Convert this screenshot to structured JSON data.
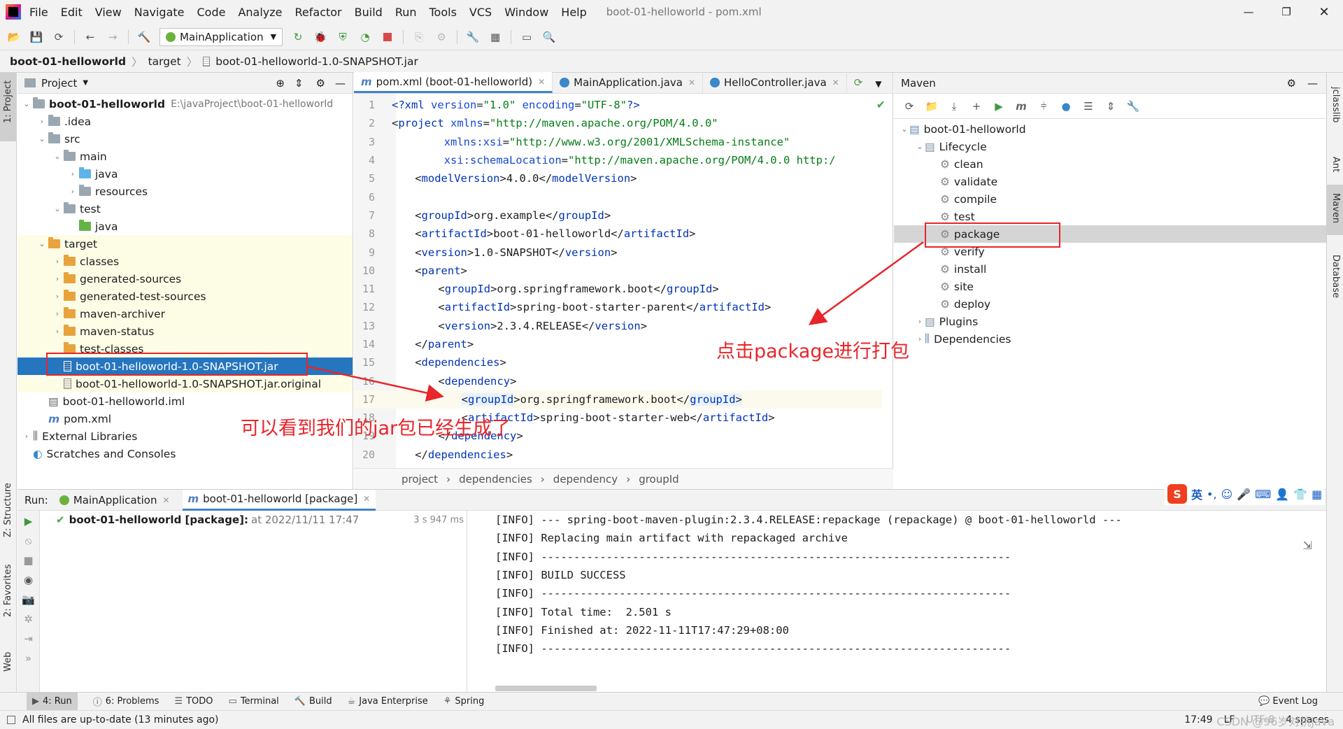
{
  "menubar": {
    "items": [
      "File",
      "Edit",
      "View",
      "Navigate",
      "Code",
      "Analyze",
      "Refactor",
      "Build",
      "Run",
      "Tools",
      "VCS",
      "Window",
      "Help"
    ],
    "title": "boot-01-helloworld - pom.xml"
  },
  "toolbar": {
    "run_config": "MainApplication"
  },
  "navbar": {
    "crumbs": [
      "boot-01-helloworld",
      "target",
      "boot-01-helloworld-1.0-SNAPSHOT.jar"
    ]
  },
  "leftstrip": {
    "project": "1: Project",
    "structure": "Z: Structure",
    "favorites": "2: Favorites",
    "web": "Web"
  },
  "rightstrip": {
    "jclasslib": "jclasslib",
    "ant": "Ant",
    "maven": "Maven",
    "database": "Database"
  },
  "project": {
    "title": "Project",
    "tree": [
      {
        "label": "boot-01-helloworld",
        "extra": "E:\\javaProject\\boot-01-helloworld"
      },
      {
        "label": ".idea"
      },
      {
        "label": "src"
      },
      {
        "label": "main"
      },
      {
        "label": "java"
      },
      {
        "label": "resources"
      },
      {
        "label": "test"
      },
      {
        "label": "java"
      },
      {
        "label": "target"
      },
      {
        "label": "classes"
      },
      {
        "label": "generated-sources"
      },
      {
        "label": "generated-test-sources"
      },
      {
        "label": "maven-archiver"
      },
      {
        "label": "maven-status"
      },
      {
        "label": "test-classes"
      },
      {
        "label": "boot-01-helloworld-1.0-SNAPSHOT.jar"
      },
      {
        "label": "boot-01-helloworld-1.0-SNAPSHOT.jar.original"
      },
      {
        "label": "boot-01-helloworld.iml"
      },
      {
        "label": "pom.xml"
      },
      {
        "label": "External Libraries"
      },
      {
        "label": "Scratches and Consoles"
      }
    ]
  },
  "editor": {
    "tabs": [
      "pom.xml (boot-01-helloworld)",
      "MainApplication.java",
      "HelloController.java"
    ],
    "lines": [
      {
        "n": "1",
        "parts": [
          [
            "tg",
            "<?"
          ],
          [
            "tg",
            "xml "
          ],
          [
            "at",
            "version"
          ],
          [
            "tx",
            "="
          ],
          [
            "av",
            "\"1.0\" "
          ],
          [
            "at",
            "encoding"
          ],
          [
            "tx",
            "="
          ],
          [
            "av",
            "\"UTF-8\""
          ],
          [
            "tg",
            "?>"
          ]
        ],
        "indent": 0
      },
      {
        "n": "2",
        "parts": [
          [
            "tx",
            "<"
          ],
          [
            "tg",
            "project "
          ],
          [
            "at",
            "xmlns"
          ],
          [
            "tx",
            "="
          ],
          [
            "av",
            "\"http://maven.apache.org/POM/4.0.0\""
          ]
        ],
        "indent": 0
      },
      {
        "n": "3",
        "parts": [
          [
            "at",
            "xmlns:xsi"
          ],
          [
            "tx",
            "="
          ],
          [
            "av",
            "\"http://www.w3.org/2001/XMLSchema-instance\""
          ]
        ],
        "indent": 9
      },
      {
        "n": "4",
        "parts": [
          [
            "at",
            "xsi:schemaLocation"
          ],
          [
            "tx",
            "="
          ],
          [
            "av",
            "\"http://maven.apache.org/POM/4.0.0 http:/"
          ]
        ],
        "indent": 9
      },
      {
        "n": "5",
        "parts": [
          [
            "tx",
            "<"
          ],
          [
            "tg",
            "modelVersion"
          ],
          [
            "tx",
            ">4.0.0</"
          ],
          [
            "tg",
            "modelVersion"
          ],
          [
            "tx",
            ">"
          ]
        ],
        "indent": 4
      },
      {
        "n": "6",
        "parts": [],
        "indent": 0
      },
      {
        "n": "7",
        "parts": [
          [
            "tx",
            "<"
          ],
          [
            "tg",
            "groupId"
          ],
          [
            "tx",
            ">org.example</"
          ],
          [
            "tg",
            "groupId"
          ],
          [
            "tx",
            ">"
          ]
        ],
        "indent": 4
      },
      {
        "n": "8",
        "parts": [
          [
            "tx",
            "<"
          ],
          [
            "tg",
            "artifactId"
          ],
          [
            "tx",
            ">boot-01-helloworld</"
          ],
          [
            "tg",
            "artifactId"
          ],
          [
            "tx",
            ">"
          ]
        ],
        "indent": 4
      },
      {
        "n": "9",
        "parts": [
          [
            "tx",
            "<"
          ],
          [
            "tg",
            "version"
          ],
          [
            "tx",
            ">1.0-SNAPSHOT</"
          ],
          [
            "tg",
            "version"
          ],
          [
            "tx",
            ">"
          ]
        ],
        "indent": 4
      },
      {
        "n": "10",
        "parts": [
          [
            "tx",
            "<"
          ],
          [
            "tg",
            "parent"
          ],
          [
            "tx",
            ">"
          ]
        ],
        "indent": 4
      },
      {
        "n": "11",
        "parts": [
          [
            "tx",
            "<"
          ],
          [
            "tg",
            "groupId"
          ],
          [
            "tx",
            ">org.springframework.boot</"
          ],
          [
            "tg",
            "groupId"
          ],
          [
            "tx",
            ">"
          ]
        ],
        "indent": 8
      },
      {
        "n": "12",
        "parts": [
          [
            "tx",
            "<"
          ],
          [
            "tg",
            "artifactId"
          ],
          [
            "tx",
            ">spring-boot-starter-parent</"
          ],
          [
            "tg",
            "artifactId"
          ],
          [
            "tx",
            ">"
          ]
        ],
        "indent": 8
      },
      {
        "n": "13",
        "parts": [
          [
            "tx",
            "<"
          ],
          [
            "tg",
            "version"
          ],
          [
            "tx",
            ">2.3.4.RELEASE</"
          ],
          [
            "tg",
            "version"
          ],
          [
            "tx",
            ">"
          ]
        ],
        "indent": 8
      },
      {
        "n": "14",
        "parts": [
          [
            "tx",
            "</"
          ],
          [
            "tg",
            "parent"
          ],
          [
            "tx",
            ">"
          ]
        ],
        "indent": 4
      },
      {
        "n": "15",
        "parts": [
          [
            "tx",
            "<"
          ],
          [
            "tg",
            "dependencies"
          ],
          [
            "tx",
            ">"
          ]
        ],
        "indent": 4
      },
      {
        "n": "16",
        "parts": [
          [
            "tx",
            "<"
          ],
          [
            "tg",
            "dependency"
          ],
          [
            "tx",
            ">"
          ]
        ],
        "indent": 8
      },
      {
        "n": "17",
        "parts": [
          [
            "tx",
            "<"
          ],
          [
            "tg",
            "groupId"
          ],
          [
            "tx",
            ">org.springframework.boot</"
          ],
          [
            "tg",
            "groupId"
          ],
          [
            "tx",
            ">"
          ]
        ],
        "indent": 12
      },
      {
        "n": "18",
        "parts": [
          [
            "tx",
            "<"
          ],
          [
            "tg",
            "artifactId"
          ],
          [
            "tx",
            ">spring-boot-starter-web</"
          ],
          [
            "tg",
            "artifactId"
          ],
          [
            "tx",
            ">"
          ]
        ],
        "indent": 12
      },
      {
        "n": "19",
        "parts": [
          [
            "tx",
            "</"
          ],
          [
            "tg",
            "dependency"
          ],
          [
            "tx",
            ">"
          ]
        ],
        "indent": 8
      },
      {
        "n": "20",
        "parts": [
          [
            "tx",
            "</"
          ],
          [
            "tg",
            "dependencies"
          ],
          [
            "tx",
            ">"
          ]
        ],
        "indent": 4
      }
    ],
    "breadcrumbs": [
      "project",
      "dependencies",
      "dependency",
      "groupId"
    ]
  },
  "maven": {
    "title": "Maven",
    "root": "boot-01-helloworld",
    "lifecycle": "Lifecycle",
    "phases": [
      "clean",
      "validate",
      "compile",
      "test",
      "package",
      "verify",
      "install",
      "site",
      "deploy"
    ],
    "plugins": "Plugins",
    "dependencies": "Dependencies"
  },
  "run": {
    "label": "Run:",
    "tabs": [
      "MainApplication",
      "boot-01-helloworld [package]"
    ],
    "task": "boot-01-helloworld [package]:",
    "task_time": "at 2022/11/11 17:47",
    "duration": "3 s 947 ms",
    "console": [
      "[INFO] --- spring-boot-maven-plugin:2.3.4.RELEASE:repackage (repackage) @ boot-01-helloworld ---",
      "[INFO] Replacing main artifact with repackaged archive",
      "[INFO] ------------------------------------------------------------------------",
      "[INFO] BUILD SUCCESS",
      "[INFO] ------------------------------------------------------------------------",
      "[INFO] Total time:  2.501 s",
      "[INFO] Finished at: 2022-11-11T17:47:29+08:00",
      "[INFO] ------------------------------------------------------------------------"
    ]
  },
  "toolwindows": [
    "4: Run",
    "6: Problems",
    "TODO",
    "Terminal",
    "Build",
    "Java Enterprise",
    "Spring"
  ],
  "event_log": "Event Log",
  "status": {
    "message": "All files are up-to-date (13 minutes ago)",
    "time": "17:49",
    "lf": "LF",
    "encoding": "UTF-8",
    "indent": "4 spaces",
    "watermark": "CSDN @96岁对抗java"
  },
  "annotations": {
    "package_note": "点击package进行打包",
    "jar_note": "可以看到我们的jar包已经生成了"
  },
  "ime": {
    "lang": "英"
  }
}
